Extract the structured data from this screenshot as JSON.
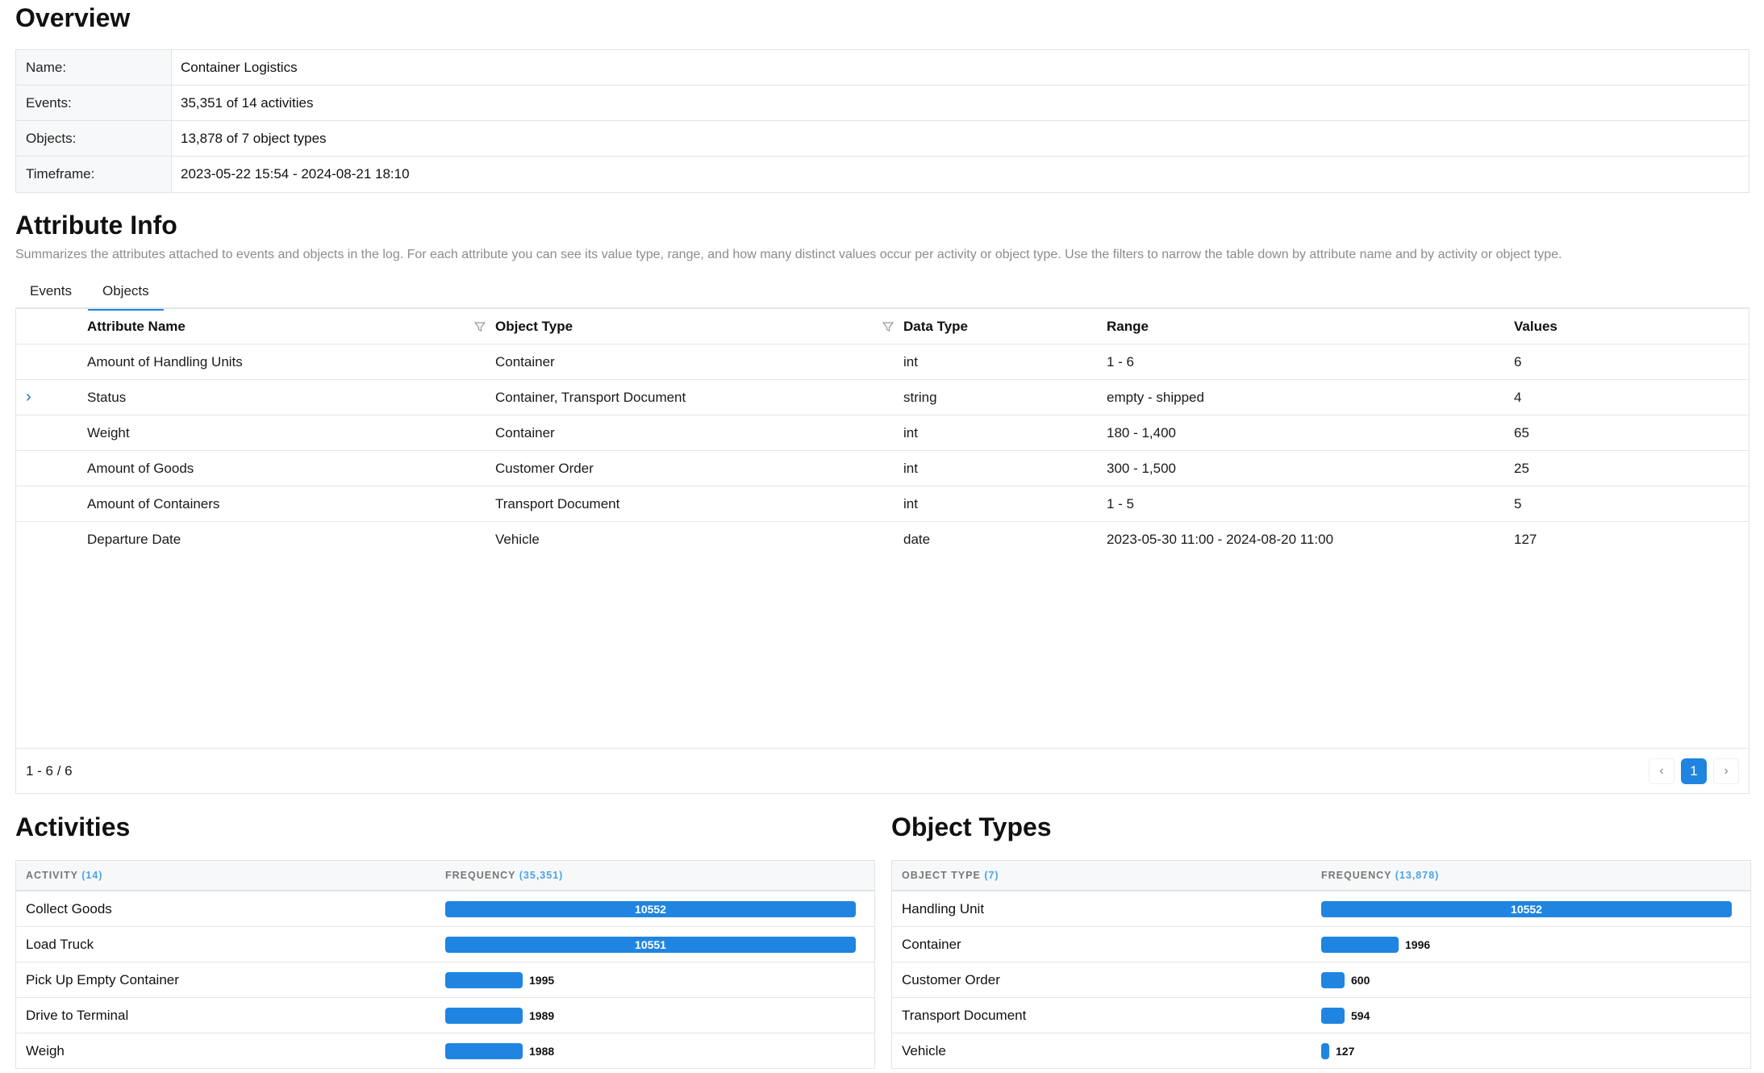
{
  "overview": {
    "title": "Overview",
    "rows": [
      {
        "key": "Name:",
        "value": "Container Logistics"
      },
      {
        "key": "Events:",
        "value": "35,351 of 14 activities"
      },
      {
        "key": "Objects:",
        "value": "13,878 of 7 object types"
      },
      {
        "key": "Timeframe:",
        "value": "2023-05-22 15:54 - 2024-08-21 18:10"
      }
    ]
  },
  "attribute_info": {
    "title": "Attribute Info",
    "description": "Summarizes the attributes attached to events and objects in the log. For each attribute you can see its value type, range, and how many distinct values occur per activity or object type. Use the filters to narrow the table down by attribute name and by activity or object type.",
    "tabs": [
      {
        "label": "Events",
        "active": false
      },
      {
        "label": "Objects",
        "active": true
      }
    ],
    "columns": {
      "name": "Attribute Name",
      "object_type": "Object Type",
      "data_type": "Data Type",
      "range": "Range",
      "values": "Values"
    },
    "rows": [
      {
        "expand": "",
        "name": "Amount of Handling Units",
        "object_type": "Container",
        "data_type": "int",
        "range": "1 - 6",
        "values": "6"
      },
      {
        "expand": "›",
        "name": "Status",
        "object_type": "Container, Transport Document",
        "data_type": "string",
        "range": "empty - shipped",
        "values": "4"
      },
      {
        "expand": "",
        "name": "Weight",
        "object_type": "Container",
        "data_type": "int",
        "range": "180 - 1,400",
        "values": "65"
      },
      {
        "expand": "",
        "name": "Amount of Goods",
        "object_type": "Customer Order",
        "data_type": "int",
        "range": "300 - 1,500",
        "values": "25"
      },
      {
        "expand": "",
        "name": "Amount of Containers",
        "object_type": "Transport Document",
        "data_type": "int",
        "range": "1 - 5",
        "values": "5"
      },
      {
        "expand": "",
        "name": "Departure Date",
        "object_type": "Vehicle",
        "data_type": "date",
        "range": "2023-05-30 11:00 - 2024-08-20 11:00",
        "values": "127"
      }
    ],
    "footer": {
      "range_text": "1 - 6 / 6",
      "current_page": "1",
      "prev_icon": "‹",
      "next_icon": "›"
    }
  },
  "activities": {
    "title": "Activities",
    "header_col1": "ACTIVITY",
    "header_col1_count": "(14)",
    "header_col2": "FREQUENCY",
    "header_col2_count": "(35,351)",
    "max": 10552,
    "rows": [
      {
        "label": "Collect Goods",
        "value": 10552
      },
      {
        "label": "Load Truck",
        "value": 10551
      },
      {
        "label": "Pick Up Empty Container",
        "value": 1995
      },
      {
        "label": "Drive to Terminal",
        "value": 1989
      },
      {
        "label": "Weigh",
        "value": 1988
      }
    ]
  },
  "object_types": {
    "title": "Object Types",
    "header_col1": "OBJECT TYPE",
    "header_col1_count": "(7)",
    "header_col2": "FREQUENCY",
    "header_col2_count": "(13,878)",
    "max": 10552,
    "rows": [
      {
        "label": "Handling Unit",
        "value": 10552
      },
      {
        "label": "Container",
        "value": 1996
      },
      {
        "label": "Customer Order",
        "value": 600
      },
      {
        "label": "Transport Document",
        "value": 594
      },
      {
        "label": "Vehicle",
        "value": 127
      }
    ]
  },
  "colors": {
    "accent": "#1f85e0",
    "muted_text": "#8c8c8c"
  }
}
